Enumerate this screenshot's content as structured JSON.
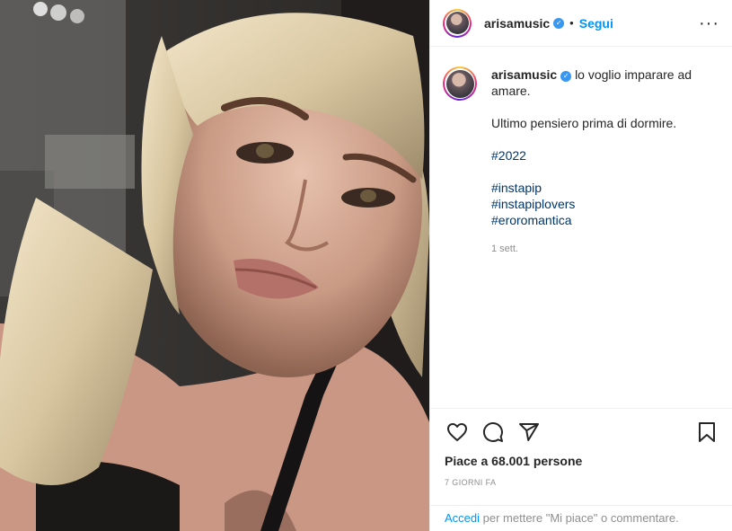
{
  "post": {
    "author": {
      "username": "arisamusic",
      "verified_icon": "verified-badge-icon",
      "follow_label": "Segui",
      "separator": "•"
    },
    "more_options_icon": "more-horizontal-icon",
    "caption": {
      "first_line": "lo voglio imparare ad amare.",
      "second_line": "Ultimo pensiero prima di dormire.",
      "hashtags": [
        "#2022",
        "#instapip",
        "#instapiplovers",
        "#eroromantica"
      ],
      "time": "1 sett."
    },
    "actions": {
      "like_icon": "heart-icon",
      "comment_icon": "comment-icon",
      "share_icon": "paper-plane-icon",
      "save_icon": "bookmark-icon"
    },
    "likes_text": "Piace a 68.001 persone",
    "date_text": "7 GIORNI FA",
    "login_prompt": {
      "link": "Accedi",
      "rest": " per mettere \"Mi piace\" o commentare."
    }
  },
  "colors": {
    "accent": "#0095f6",
    "hashtag": "#00376b",
    "muted": "#8e8e8e",
    "verified": "#3897f0"
  }
}
